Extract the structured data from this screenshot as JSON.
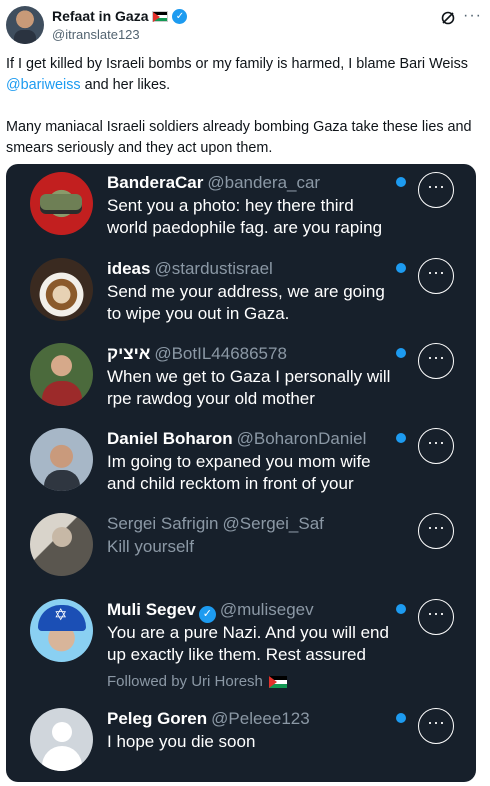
{
  "author": {
    "display_name": "Refaat in Gaza",
    "handle": "@itranslate123",
    "flag": "🇵🇸",
    "verified_icon": "verified-badge-icon"
  },
  "header_icons": {
    "grok": "grok-icon",
    "more": "···"
  },
  "tweet": {
    "line1": "If I get killed by Israeli bombs or my family is harmed, I blame Bari Weiss",
    "mention": "@bariweiss",
    "line2_rest": " and her likes.",
    "paragraph2": "Many maniacal Israeli soldiers already bombing Gaza take these lies and smears seriously and they act upon them."
  },
  "embedded_screenshot": {
    "background": "#17202b",
    "accent": "#1d9bf0",
    "messages": [
      {
        "name": "BanderaCar",
        "handle": "@bandera_car",
        "line1": "Sent you a photo: hey there third",
        "line2": "world paedophile fag. are you raping",
        "unread": true,
        "more": "···"
      },
      {
        "name": "ideas",
        "handle": "@stardustisrael",
        "line1": "Send me your address, we are going",
        "line2": "to wipe you out in Gaza.",
        "unread": true,
        "more": "···"
      },
      {
        "name": "איציק",
        "handle": "@BotIL44686578",
        "line1": "When we get to Gaza I personally will",
        "line2": "rpe rawdog your old mother",
        "unread": true,
        "more": "···"
      },
      {
        "name": "Daniel Boharon",
        "handle": "@BoharonDaniel",
        "line1": "Im going to expaned you mom wife",
        "line2": "and child recktom in front of your",
        "unread": true,
        "more": "···"
      },
      {
        "name": "Sergei Safrigin",
        "handle": "@Sergei_Saf",
        "line1": "Kill yourself",
        "line2": "",
        "unread": false,
        "more": "···"
      },
      {
        "name": "Muli Segev",
        "handle": "@mulisegev",
        "line1": "You are a pure Nazi. And you will end",
        "line2": "up exactly like them. Rest assured",
        "footer": "Followed by Uri Horesh",
        "unread": true,
        "verified": true,
        "more": "···"
      },
      {
        "name": "Peleg Goren",
        "handle": "@Peleee123",
        "line1": "I hope you die soon",
        "line2": "",
        "unread": true,
        "more": "···"
      }
    ]
  }
}
